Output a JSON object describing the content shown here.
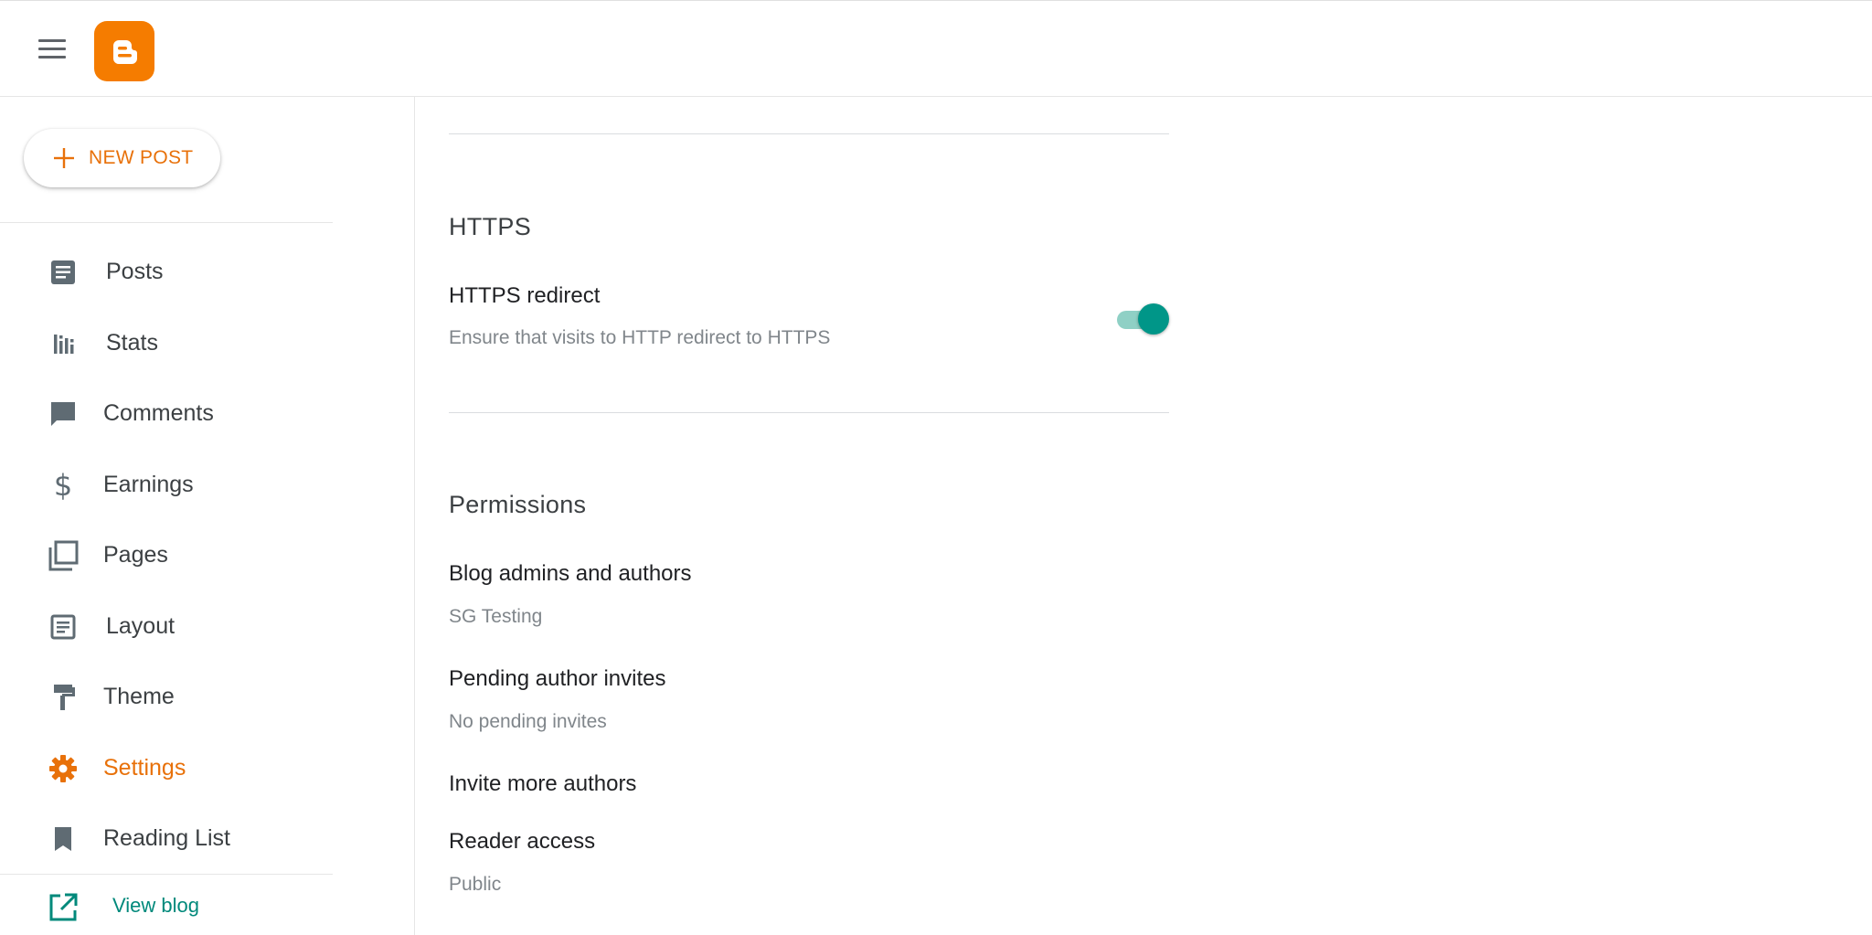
{
  "header": {
    "menu_icon": "hamburger-icon",
    "logo_icon": "blogger-logo-icon",
    "brand_color": "#f57c00"
  },
  "sidebar": {
    "new_post_label": "NEW POST",
    "items": [
      {
        "label": "Posts",
        "icon": "posts-icon"
      },
      {
        "label": "Stats",
        "icon": "stats-icon"
      },
      {
        "label": "Comments",
        "icon": "comments-icon"
      },
      {
        "label": "Earnings",
        "icon": "dollar-icon"
      },
      {
        "label": "Pages",
        "icon": "pages-icon"
      },
      {
        "label": "Layout",
        "icon": "layout-icon"
      },
      {
        "label": "Theme",
        "icon": "paint-roller-icon"
      },
      {
        "label": "Settings",
        "icon": "gear-icon",
        "active": true
      },
      {
        "label": "Reading List",
        "icon": "bookmark-icon"
      }
    ],
    "view_blog_label": "View blog",
    "active_color": "#e8710a",
    "link_color": "#00897b"
  },
  "main": {
    "https": {
      "section_title": "HTTPS",
      "redirect_title": "HTTPS redirect",
      "redirect_desc": "Ensure that visits to HTTP redirect to HTTPS",
      "redirect_enabled": true
    },
    "permissions": {
      "section_title": "Permissions",
      "admins_title": "Blog admins and authors",
      "admins_value": "SG Testing",
      "pending_title": "Pending author invites",
      "pending_value": "No pending invites",
      "invite_title": "Invite more authors",
      "reader_title": "Reader access",
      "reader_value": "Public"
    }
  }
}
